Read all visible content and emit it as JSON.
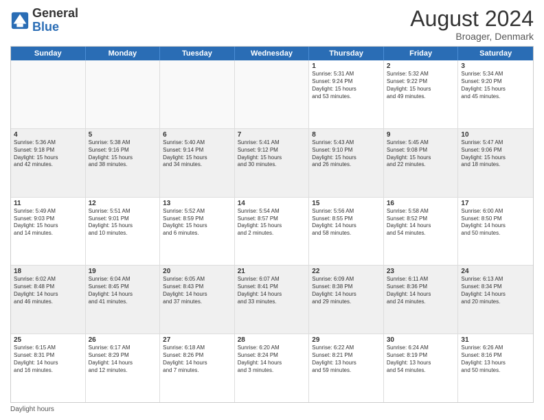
{
  "header": {
    "logo_general": "General",
    "logo_blue": "Blue",
    "month_year": "August 2024",
    "location": "Broager, Denmark"
  },
  "calendar": {
    "days_of_week": [
      "Sunday",
      "Monday",
      "Tuesday",
      "Wednesday",
      "Thursday",
      "Friday",
      "Saturday"
    ],
    "rows": [
      [
        {
          "day": "",
          "info": "",
          "empty": true
        },
        {
          "day": "",
          "info": "",
          "empty": true
        },
        {
          "day": "",
          "info": "",
          "empty": true
        },
        {
          "day": "",
          "info": "",
          "empty": true
        },
        {
          "day": "1",
          "info": "Sunrise: 5:31 AM\nSunset: 9:24 PM\nDaylight: 15 hours\nand 53 minutes.",
          "empty": false
        },
        {
          "day": "2",
          "info": "Sunrise: 5:32 AM\nSunset: 9:22 PM\nDaylight: 15 hours\nand 49 minutes.",
          "empty": false
        },
        {
          "day": "3",
          "info": "Sunrise: 5:34 AM\nSunset: 9:20 PM\nDaylight: 15 hours\nand 45 minutes.",
          "empty": false
        }
      ],
      [
        {
          "day": "4",
          "info": "Sunrise: 5:36 AM\nSunset: 9:18 PM\nDaylight: 15 hours\nand 42 minutes.",
          "empty": false
        },
        {
          "day": "5",
          "info": "Sunrise: 5:38 AM\nSunset: 9:16 PM\nDaylight: 15 hours\nand 38 minutes.",
          "empty": false
        },
        {
          "day": "6",
          "info": "Sunrise: 5:40 AM\nSunset: 9:14 PM\nDaylight: 15 hours\nand 34 minutes.",
          "empty": false
        },
        {
          "day": "7",
          "info": "Sunrise: 5:41 AM\nSunset: 9:12 PM\nDaylight: 15 hours\nand 30 minutes.",
          "empty": false
        },
        {
          "day": "8",
          "info": "Sunrise: 5:43 AM\nSunset: 9:10 PM\nDaylight: 15 hours\nand 26 minutes.",
          "empty": false
        },
        {
          "day": "9",
          "info": "Sunrise: 5:45 AM\nSunset: 9:08 PM\nDaylight: 15 hours\nand 22 minutes.",
          "empty": false
        },
        {
          "day": "10",
          "info": "Sunrise: 5:47 AM\nSunset: 9:06 PM\nDaylight: 15 hours\nand 18 minutes.",
          "empty": false
        }
      ],
      [
        {
          "day": "11",
          "info": "Sunrise: 5:49 AM\nSunset: 9:03 PM\nDaylight: 15 hours\nand 14 minutes.",
          "empty": false
        },
        {
          "day": "12",
          "info": "Sunrise: 5:51 AM\nSunset: 9:01 PM\nDaylight: 15 hours\nand 10 minutes.",
          "empty": false
        },
        {
          "day": "13",
          "info": "Sunrise: 5:52 AM\nSunset: 8:59 PM\nDaylight: 15 hours\nand 6 minutes.",
          "empty": false
        },
        {
          "day": "14",
          "info": "Sunrise: 5:54 AM\nSunset: 8:57 PM\nDaylight: 15 hours\nand 2 minutes.",
          "empty": false
        },
        {
          "day": "15",
          "info": "Sunrise: 5:56 AM\nSunset: 8:55 PM\nDaylight: 14 hours\nand 58 minutes.",
          "empty": false
        },
        {
          "day": "16",
          "info": "Sunrise: 5:58 AM\nSunset: 8:52 PM\nDaylight: 14 hours\nand 54 minutes.",
          "empty": false
        },
        {
          "day": "17",
          "info": "Sunrise: 6:00 AM\nSunset: 8:50 PM\nDaylight: 14 hours\nand 50 minutes.",
          "empty": false
        }
      ],
      [
        {
          "day": "18",
          "info": "Sunrise: 6:02 AM\nSunset: 8:48 PM\nDaylight: 14 hours\nand 46 minutes.",
          "empty": false
        },
        {
          "day": "19",
          "info": "Sunrise: 6:04 AM\nSunset: 8:45 PM\nDaylight: 14 hours\nand 41 minutes.",
          "empty": false
        },
        {
          "day": "20",
          "info": "Sunrise: 6:05 AM\nSunset: 8:43 PM\nDaylight: 14 hours\nand 37 minutes.",
          "empty": false
        },
        {
          "day": "21",
          "info": "Sunrise: 6:07 AM\nSunset: 8:41 PM\nDaylight: 14 hours\nand 33 minutes.",
          "empty": false
        },
        {
          "day": "22",
          "info": "Sunrise: 6:09 AM\nSunset: 8:38 PM\nDaylight: 14 hours\nand 29 minutes.",
          "empty": false
        },
        {
          "day": "23",
          "info": "Sunrise: 6:11 AM\nSunset: 8:36 PM\nDaylight: 14 hours\nand 24 minutes.",
          "empty": false
        },
        {
          "day": "24",
          "info": "Sunrise: 6:13 AM\nSunset: 8:34 PM\nDaylight: 14 hours\nand 20 minutes.",
          "empty": false
        }
      ],
      [
        {
          "day": "25",
          "info": "Sunrise: 6:15 AM\nSunset: 8:31 PM\nDaylight: 14 hours\nand 16 minutes.",
          "empty": false
        },
        {
          "day": "26",
          "info": "Sunrise: 6:17 AM\nSunset: 8:29 PM\nDaylight: 14 hours\nand 12 minutes.",
          "empty": false
        },
        {
          "day": "27",
          "info": "Sunrise: 6:18 AM\nSunset: 8:26 PM\nDaylight: 14 hours\nand 7 minutes.",
          "empty": false
        },
        {
          "day": "28",
          "info": "Sunrise: 6:20 AM\nSunset: 8:24 PM\nDaylight: 14 hours\nand 3 minutes.",
          "empty": false
        },
        {
          "day": "29",
          "info": "Sunrise: 6:22 AM\nSunset: 8:21 PM\nDaylight: 13 hours\nand 59 minutes.",
          "empty": false
        },
        {
          "day": "30",
          "info": "Sunrise: 6:24 AM\nSunset: 8:19 PM\nDaylight: 13 hours\nand 54 minutes.",
          "empty": false
        },
        {
          "day": "31",
          "info": "Sunrise: 6:26 AM\nSunset: 8:16 PM\nDaylight: 13 hours\nand 50 minutes.",
          "empty": false
        }
      ]
    ]
  },
  "footer": {
    "label": "Daylight hours"
  }
}
